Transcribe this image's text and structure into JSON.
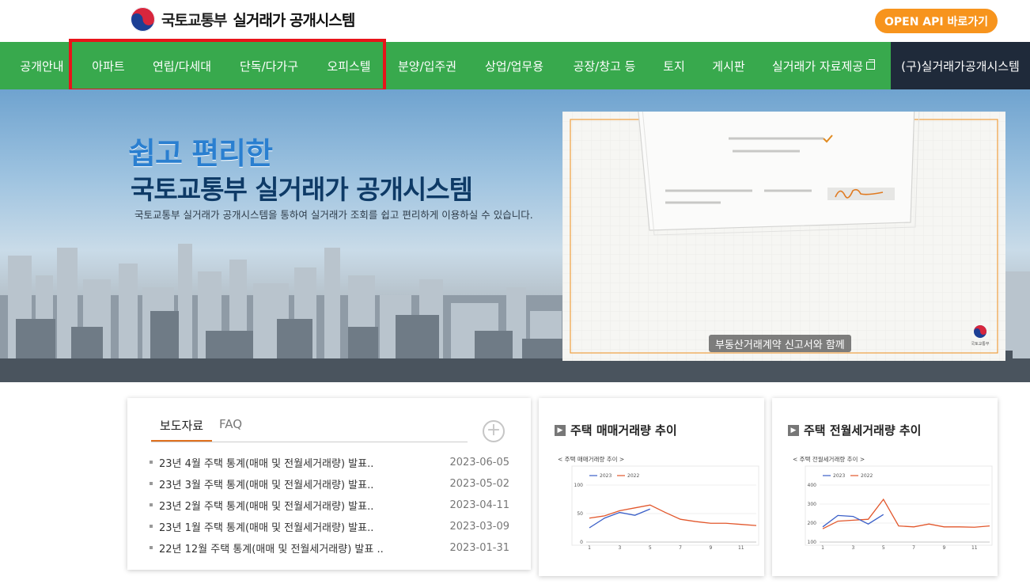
{
  "header": {
    "ministry": "국토교통부",
    "system": "실거래가 공개시스템",
    "api_button": "OPEN API 바로가기"
  },
  "nav": {
    "items": [
      "공개안내",
      "아파트",
      "연립/다세대",
      "단독/다가구",
      "오피스텔",
      "분양/입주권",
      "상업/업무용",
      "공장/창고 등",
      "토지",
      "게시판",
      "실거래가 자료제공"
    ],
    "old_system": "(구)실거래가공개시스템"
  },
  "hero": {
    "title1": "쉽고 편리한",
    "title2": "국토교통부 실거래가 공개시스템",
    "subtitle": "국토교통부 실거래가 공개시스템을 통하여 실거래가 조회를 쉽고 편리하게 이용하실 수 있습니다.",
    "video_caption": "부동산거래계약 신고서와 함께",
    "video_logo": "국토교통부"
  },
  "news": {
    "tabs": [
      "보도자료",
      "FAQ"
    ],
    "more": "+",
    "items": [
      {
        "title": "23년 4월 주택 통계(매매 및 전월세거래량) 발표..",
        "date": "2023-06-05"
      },
      {
        "title": "23년 3월 주택 통계(매매 및 전월세거래량) 발표..",
        "date": "2023-05-02"
      },
      {
        "title": "23년 2월 주택 통계(매매 및 전월세거래량) 발표..",
        "date": "2023-04-11"
      },
      {
        "title": "23년 1월 주택 통계(매매 및 전월세거래량) 발표..",
        "date": "2023-03-09"
      },
      {
        "title": "22년 12월 주택 통계(매매 및 전월세거래량) 발표 ..",
        "date": "2023-01-31"
      }
    ]
  },
  "charts": {
    "sale": {
      "heading": "주택 매매거래량 추이",
      "inner_title": "< 주택 매매거래량 추이 >"
    },
    "rent": {
      "heading": "주택 전월세거래량 추이",
      "inner_title": "< 주택 전월세거래량 추이 >"
    }
  },
  "chart_data": [
    {
      "type": "line",
      "title": "< 주택 매매거래량 추이 >",
      "x": [
        1,
        2,
        3,
        4,
        5,
        6,
        7,
        8,
        9,
        10,
        11,
        12
      ],
      "xticks": [
        1,
        3,
        5,
        7,
        9,
        11
      ],
      "yticks": [
        0,
        50,
        100
      ],
      "ylim": [
        0,
        100
      ],
      "series": [
        {
          "name": "2023",
          "color": "#3a5fc8",
          "values": [
            25,
            42,
            52,
            47,
            58
          ]
        },
        {
          "name": "2022",
          "color": "#e2572c",
          "values": [
            42,
            46,
            55,
            60,
            65,
            52,
            40,
            36,
            33,
            33,
            31,
            29
          ]
        }
      ]
    },
    {
      "type": "line",
      "title": "< 주택 전월세거래량 추이 >",
      "x": [
        1,
        2,
        3,
        4,
        5,
        6,
        7,
        8,
        9,
        10,
        11,
        12
      ],
      "xticks": [
        1,
        3,
        5,
        7,
        9,
        11
      ],
      "yticks": [
        100,
        200,
        300,
        400
      ],
      "ylim": [
        100,
        400
      ],
      "series": [
        {
          "name": "2023",
          "color": "#3a5fc8",
          "values": [
            180,
            240,
            235,
            195,
            245
          ]
        },
        {
          "name": "2022",
          "color": "#e2572c",
          "values": [
            170,
            210,
            215,
            220,
            325,
            185,
            180,
            195,
            180,
            180,
            178,
            185
          ]
        }
      ]
    }
  ]
}
